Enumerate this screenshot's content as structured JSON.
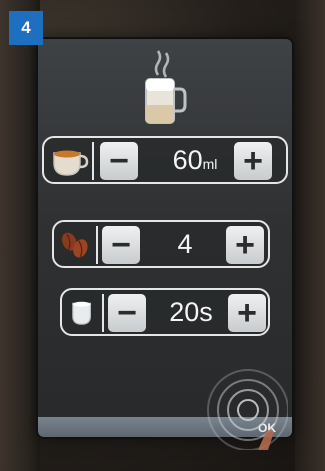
{
  "step_badge": {
    "label": "4",
    "color": "#1e6fc0"
  },
  "header_icon": "latte-macchiato-glass-icon",
  "settings": [
    {
      "icon": "coffee-cup-icon",
      "value": "60",
      "unit": "ml",
      "minus_label": "−",
      "plus_label": "+"
    },
    {
      "icon": "coffee-beans-icon",
      "value": "4",
      "unit": "",
      "minus_label": "−",
      "plus_label": "+"
    },
    {
      "icon": "milk-cup-icon",
      "value": "20s",
      "unit": "",
      "minus_label": "−",
      "plus_label": "+"
    }
  ],
  "footer": {
    "ok_label": "OK"
  }
}
